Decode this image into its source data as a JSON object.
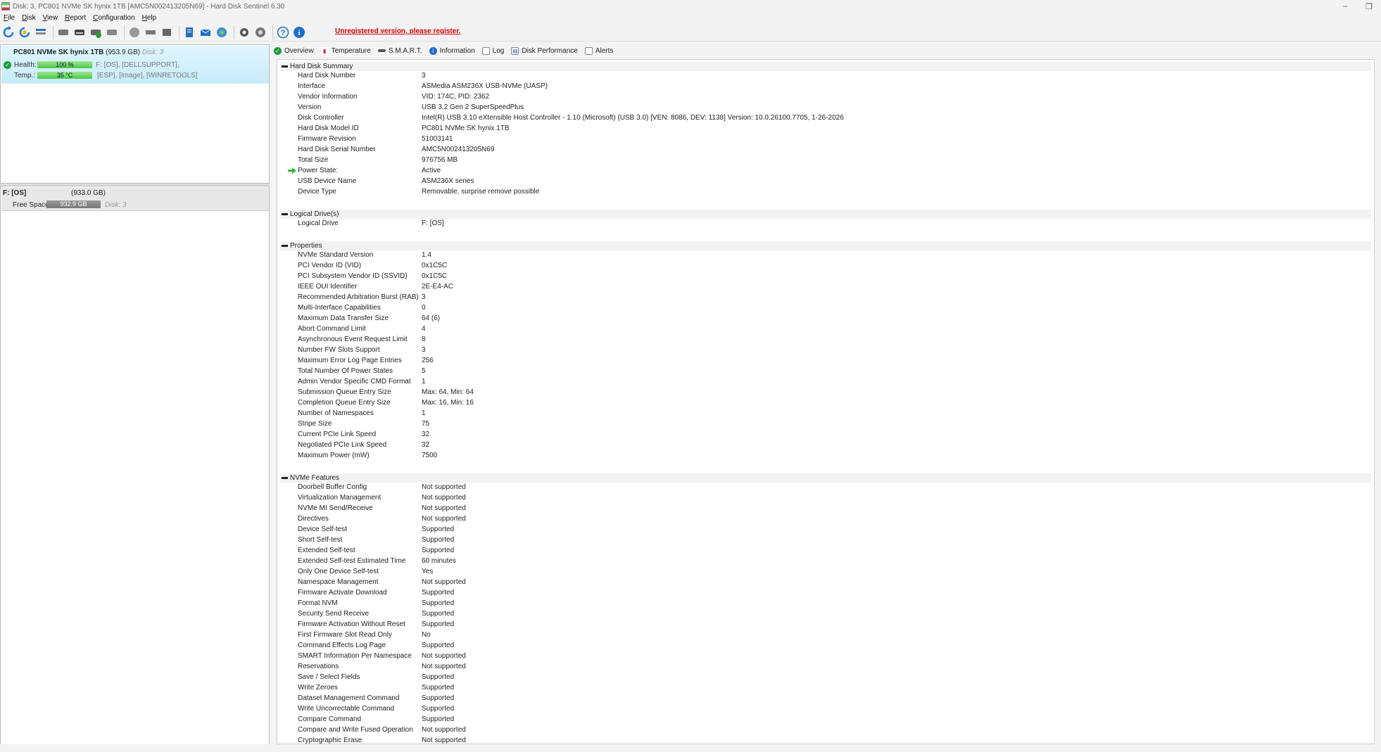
{
  "window": {
    "title": "Disk: 3, PC801 NVMe SK hynix 1TB [AMC5N002413205N69]  -  Hard Disk Sentinel 6.30"
  },
  "menu": [
    {
      "key": "F",
      "rest": "ile"
    },
    {
      "key": "D",
      "rest": "isk"
    },
    {
      "key": "V",
      "rest": "iew"
    },
    {
      "key": "R",
      "rest": "eport"
    },
    {
      "key": "C",
      "rest": "onfiguration"
    },
    {
      "key": "H",
      "rest": "elp"
    }
  ],
  "toolbar": {
    "unregistered_text": "Unregistered version, please register."
  },
  "disk": {
    "name": "PC801 NVMe SK hynix 1TB",
    "capacity": "(953.9 GB)",
    "disk_label": "Disk: 3",
    "health_label": "Health:",
    "health_value": "100 %",
    "health_pct": 100,
    "temp_label": "Temp.:",
    "temp_value": "35 °C",
    "drives_line1": "F: [OS],  [DELLSUPPORT],",
    "drives_line2": "[ESP],  [Image],  [WINRETOOLS]"
  },
  "volume": {
    "name": "F: [OS]",
    "size": "(933.0 GB)",
    "free_label": "Free Space",
    "free_value": "932.9 GB",
    "disk_label": "Disk: 3"
  },
  "tabs": [
    "Overview",
    "Temperature",
    "S.M.A.R.T.",
    "Information",
    "Log",
    "Disk Performance",
    "Alerts"
  ],
  "sections": {
    "summary": {
      "title": "Hard Disk Summary",
      "rows": [
        [
          "Hard Disk Number",
          "3"
        ],
        [
          "Interface",
          "ASMedia ASM236X USB-NVMe (UASP)"
        ],
        [
          "Vendor Information",
          "VID: 174C, PID: 2362"
        ],
        [
          "Version",
          "USB 3.2 Gen 2 SuperSpeedPlus"
        ],
        [
          "Disk Controller",
          "Intel(R) USB 3.10 eXtensible Host Controller - 1.10 (Microsoft) (USB 3.0) [VEN: 8086, DEV: 1138] Version: 10.0.26100.7705, 1-26-2026"
        ],
        [
          "Hard Disk Model ID",
          "PC801 NVMe SK hynix 1TB"
        ],
        [
          "Firmware Revision",
          "51003141"
        ],
        [
          "Hard Disk Serial Number",
          "AMC5N002413205N69"
        ],
        [
          "Total Size",
          "976756 MB"
        ],
        [
          "Power State:",
          "Active"
        ],
        [
          "USB Device Name",
          "ASM236X series"
        ],
        [
          "Device Type",
          "Removable, surprise remove possible"
        ]
      ]
    },
    "logical": {
      "title": "Logical Drive(s)",
      "rows": [
        [
          "Logical Drive",
          "F: [OS]"
        ]
      ]
    },
    "properties": {
      "title": "Properties",
      "rows": [
        [
          "NVMe Standard Version",
          "1.4"
        ],
        [
          "PCI Vendor ID (VID)",
          "0x1C5C"
        ],
        [
          "PCI Subsystem Vendor ID (SSVID)",
          "0x1C5C"
        ],
        [
          "IEEE OUI Identifier",
          "2E-E4-AC"
        ],
        [
          "Recommended Arbitration Burst (RAB)",
          "3"
        ],
        [
          "Multi-Interface Capabilities",
          "0"
        ],
        [
          "Maximum Data Transfer Size",
          "64 (6)"
        ],
        [
          "Abort Command Limit",
          "4"
        ],
        [
          "Asynchronous Event Request Limit",
          "8"
        ],
        [
          "Number FW Slots Support",
          "3"
        ],
        [
          "Maximum Error Log Page Entries",
          "256"
        ],
        [
          "Total Number Of Power States",
          "5"
        ],
        [
          "Admin Vendor Specific CMD Format",
          "1"
        ],
        [
          "Submission Queue Entry Size",
          "Max: 64, Min: 64"
        ],
        [
          "Completion Queue Entry Size",
          "Max: 16, Min: 16"
        ],
        [
          "Number of Namespaces",
          "1"
        ],
        [
          "Stripe Size",
          "75"
        ],
        [
          "Current PCIe Link Speed",
          "32"
        ],
        [
          "Negotiated PCIe Link Speed",
          "32"
        ],
        [
          "Maximum Power (mW)",
          "7500"
        ]
      ]
    },
    "features": {
      "title": "NVMe Features",
      "rows": [
        [
          "Doorbell Buffer Config",
          "Not supported"
        ],
        [
          "Virtualization Management",
          "Not supported"
        ],
        [
          "NVMe MI Send/Receive",
          "Not supported"
        ],
        [
          "Directives",
          "Not supported"
        ],
        [
          "Device Self-test",
          "Supported"
        ],
        [
          "Short Self-test",
          "Supported"
        ],
        [
          "Extended Self-test",
          "Supported"
        ],
        [
          "Extended Self-test Estimated Time",
          "60 minutes"
        ],
        [
          "Only One Device Self-test",
          "Yes"
        ],
        [
          "Namespace Management",
          "Not supported"
        ],
        [
          "Firmware Activate Download",
          "Supported"
        ],
        [
          "Format NVM",
          "Supported"
        ],
        [
          "Security Send Receive",
          "Supported"
        ],
        [
          "Firmware Activation Without Reset",
          "Supported"
        ],
        [
          "First Firmware Slot Read Only",
          "No"
        ],
        [
          "Command Effects Log Page",
          "Supported"
        ],
        [
          "SMART Information Per Namespace",
          "Not supported"
        ],
        [
          "Reservations",
          "Not supported"
        ],
        [
          "Save / Select Fields",
          "Supported"
        ],
        [
          "Write Zeroes",
          "Supported"
        ],
        [
          "Dataset Management Command",
          "Supported"
        ],
        [
          "Write Uncorrectable Command",
          "Supported"
        ],
        [
          "Compare Command",
          "Supported"
        ],
        [
          "Compare and Write Fused Operation",
          "Not supported"
        ],
        [
          "Cryptographic Erase",
          "Not supported"
        ]
      ]
    }
  }
}
